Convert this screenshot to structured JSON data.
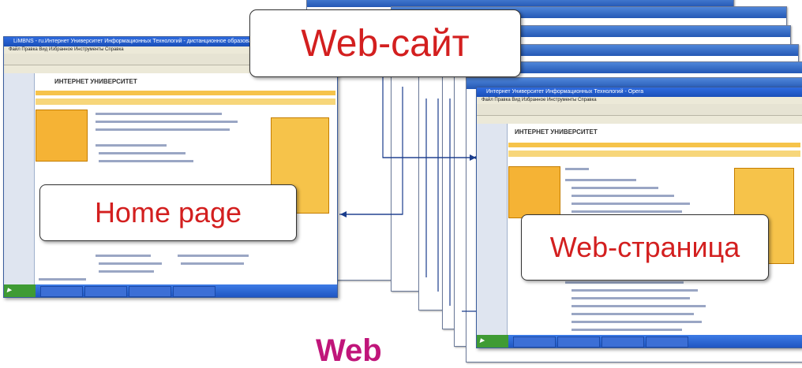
{
  "callouts": {
    "website": "Web-сайт",
    "home_page": "Home page",
    "web_page": "Web-страница"
  },
  "partial_title": "Web",
  "colors": {
    "callout_text": "#d31f1f",
    "title_magenta": "#c0157a",
    "arrow_blue": "#1a3c8c",
    "xp_blue": "#2458b5"
  },
  "left_window": {
    "title": "LiMBNS - ru.Интернет Университет Информационных Технологий - дистанционное образование - Opera",
    "menu": "Файл  Правка  Вид  Избранное  Инструменты  Справка",
    "logo": "ИНТЕРНЕТ УНИВЕРСИТЕТ"
  },
  "right_window": {
    "title": "Интернет Университет Информационных Технологий - Opera",
    "menu": "Файл  Правка  Вид  Избранное  Инструменты  Справка",
    "logo": "ИНТЕРНЕТ УНИВЕРСИТЕТ"
  }
}
